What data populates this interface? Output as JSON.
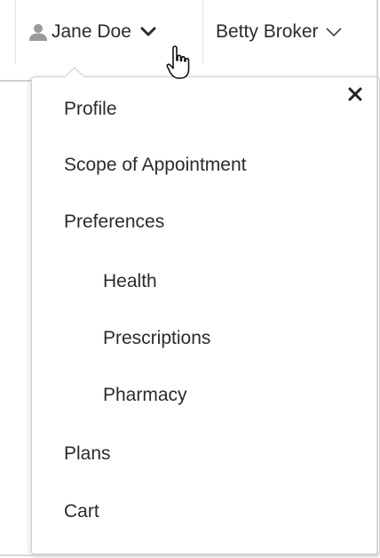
{
  "header": {
    "user_name": "Jane Doe",
    "broker_name": "Betty Broker"
  },
  "menu": {
    "items": [
      {
        "label": "Profile"
      },
      {
        "label": "Scope of Appointment"
      },
      {
        "label": "Preferences"
      },
      {
        "label": "Health",
        "sub": true
      },
      {
        "label": "Prescriptions",
        "sub": true
      },
      {
        "label": "Pharmacy",
        "sub": true
      },
      {
        "label": "Plans"
      },
      {
        "label": "Cart"
      }
    ]
  },
  "icons": {
    "user": "person-icon",
    "dropdown": "chevron-down-icon",
    "close": "close-icon",
    "cursor": "hand-pointer-icon"
  },
  "colors": {
    "text": "#2b2b2b",
    "border": "#cfcfcf",
    "icon_gray": "#9a9a9a"
  }
}
